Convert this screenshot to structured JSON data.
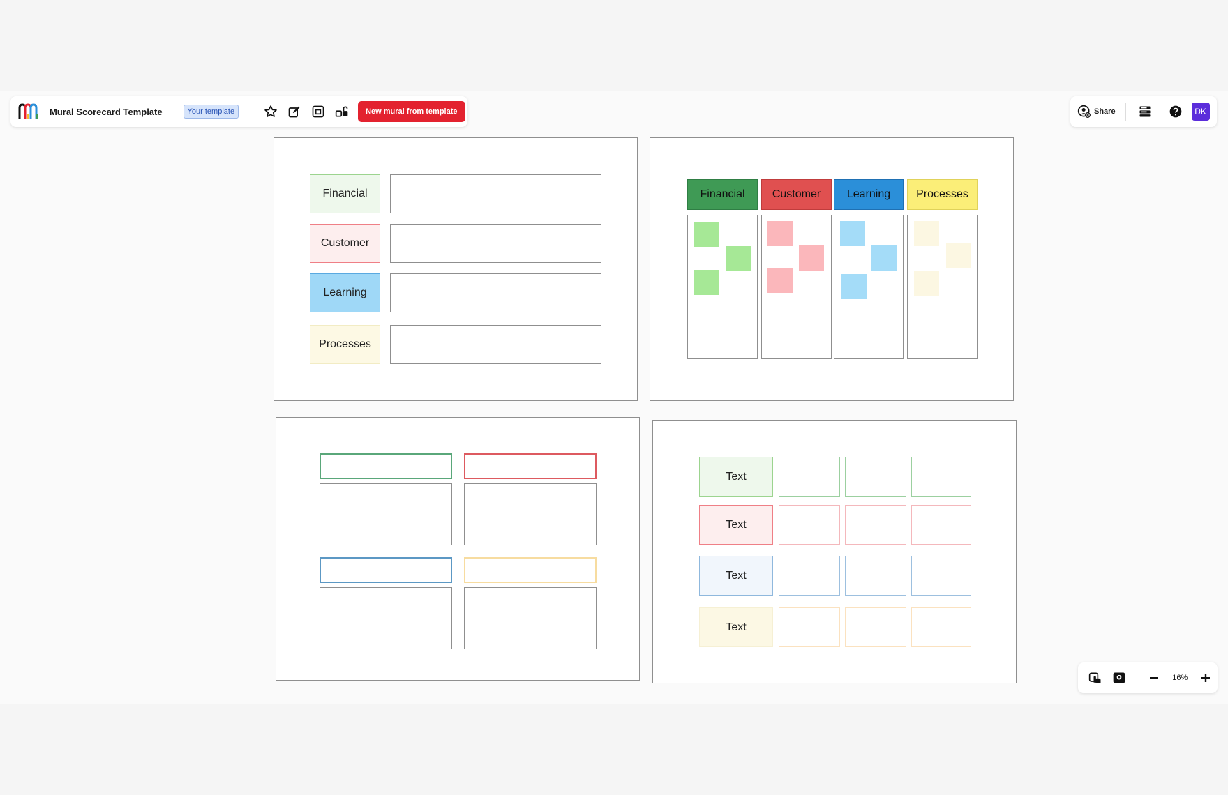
{
  "header": {
    "title": "Mural Scorecard Template",
    "badge": "Your template",
    "new_mural_button": "New mural from template",
    "share_label": "Share",
    "avatar_initials": "DK"
  },
  "zoom": {
    "level": "16%"
  },
  "colors": {
    "primary": "#e3222f",
    "avatar": "#5b2ddb",
    "green": "#3f9a55",
    "red": "#e05050",
    "blue": "#2b8fd9",
    "yellow": "#fbee78"
  },
  "panel1": {
    "rows": [
      {
        "label": "Financial"
      },
      {
        "label": "Customer"
      },
      {
        "label": "Learning"
      },
      {
        "label": "Processes"
      }
    ]
  },
  "panel2": {
    "columns": [
      {
        "label": "Financial"
      },
      {
        "label": "Customer"
      },
      {
        "label": "Learning"
      },
      {
        "label": "Processes"
      }
    ]
  },
  "panel4": {
    "rows": [
      {
        "label": "Text"
      },
      {
        "label": "Text"
      },
      {
        "label": "Text"
      },
      {
        "label": "Text"
      }
    ]
  }
}
